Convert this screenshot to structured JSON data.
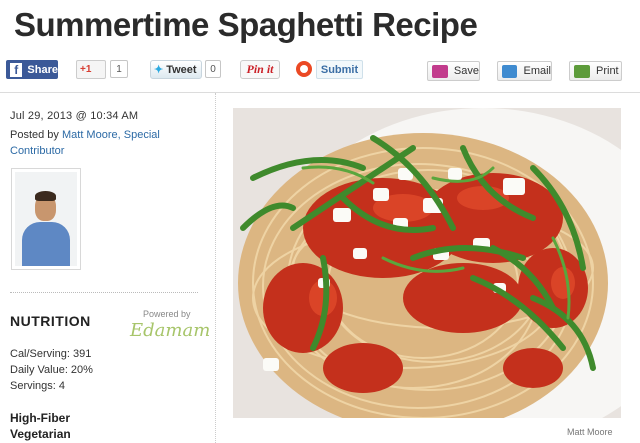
{
  "title": "Summertime Spaghetti Recipe",
  "share": {
    "facebook_icon": "f",
    "facebook_label": "Share",
    "gplus_label": "+1",
    "gplus_count": "1",
    "tweet_label": "Tweet",
    "tweet_count": "0",
    "pinterest_label": "Pin it",
    "submit_label": "Submit"
  },
  "actions": {
    "save": "Save",
    "email": "Email",
    "print": "Print"
  },
  "meta": {
    "date": "Jul 29, 2013 @ 10:34 AM",
    "posted_by": "Posted by",
    "author": "Matt Moore",
    "role": "Special Contributor"
  },
  "nutrition": {
    "title": "NUTRITION",
    "powered_by": "Powered by",
    "provider": "Edamam",
    "lines": [
      "Cal/Serving: 391",
      "Daily Value: 20%",
      "Servings: 4"
    ],
    "labels": [
      "High-Fiber",
      "Vegetarian"
    ]
  },
  "photo": {
    "credit": "Matt Moore"
  },
  "colors": {
    "facebook": "#3b5998",
    "link": "#2c6aa5",
    "tomato": "#c4301c",
    "basil": "#3f8a2c",
    "pasta": "#e6c89a"
  },
  "icons": [
    "facebook-icon",
    "gplus-icon",
    "twitter-icon",
    "pinterest-icon",
    "stumbleupon-icon",
    "save-icon",
    "email-icon",
    "print-icon"
  ]
}
